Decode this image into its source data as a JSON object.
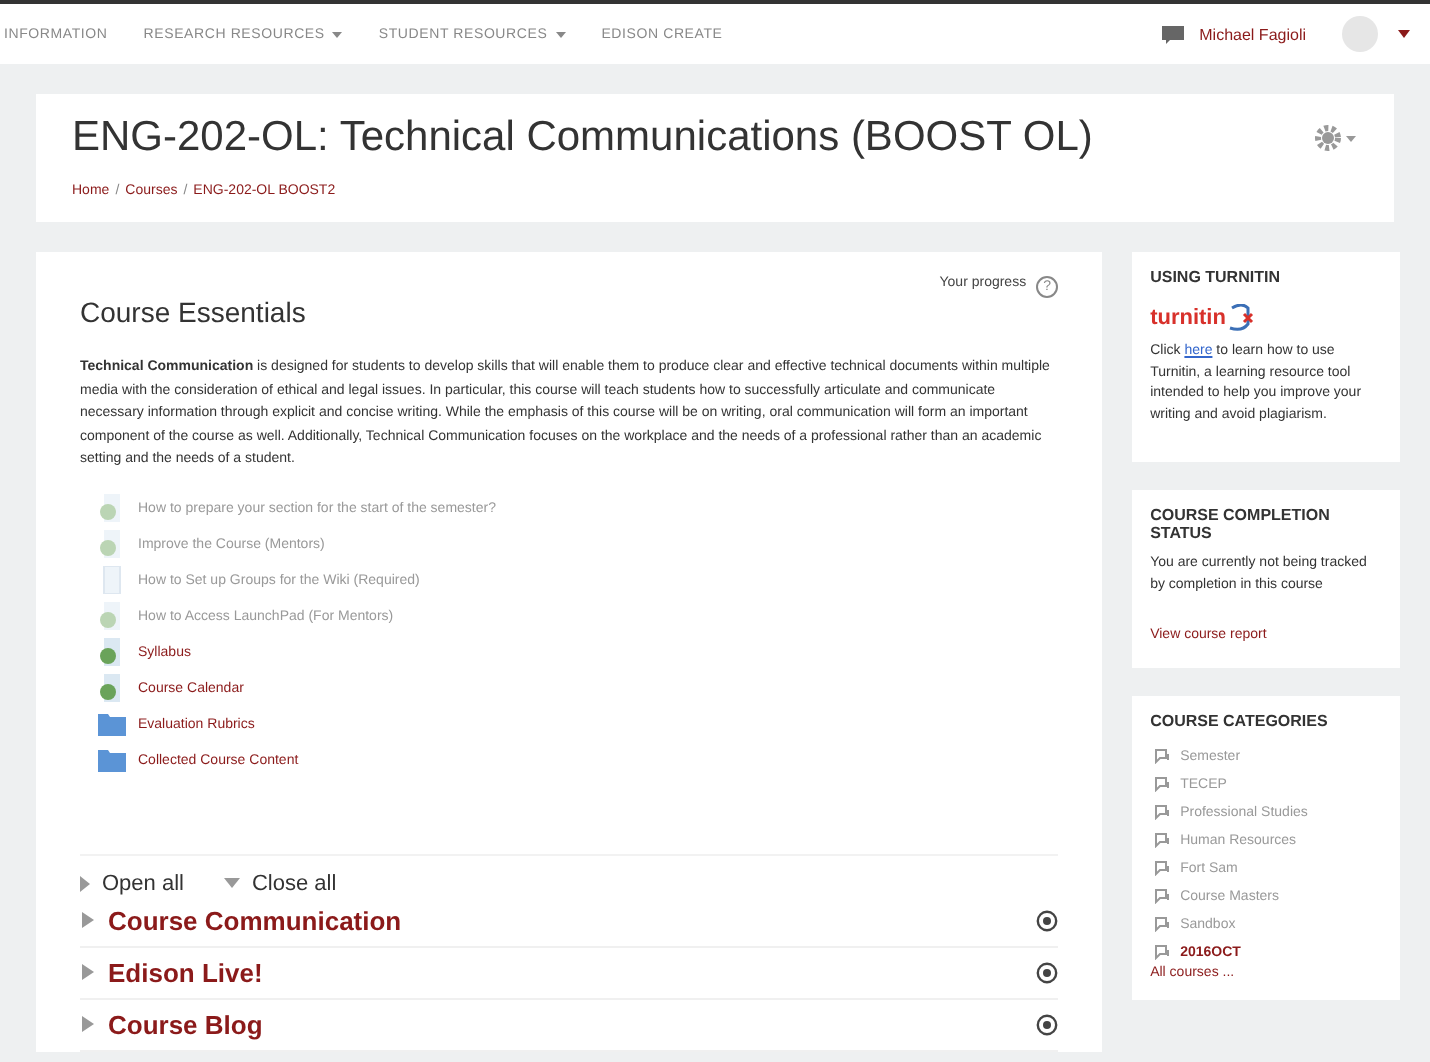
{
  "navbar": {
    "items": [
      {
        "label": "INFORMATION",
        "dropdown": false
      },
      {
        "label": "RESEARCH RESOURCES",
        "dropdown": true
      },
      {
        "label": "STUDENT RESOURCES",
        "dropdown": true
      },
      {
        "label": "EDISON CREATE",
        "dropdown": false
      }
    ],
    "user": "Michael Fagioli"
  },
  "header": {
    "title": "ENG-202-OL: Technical Communications (BOOST OL)",
    "breadcrumb": [
      "Home",
      "Courses",
      "ENG-202-OL BOOST2"
    ],
    "separator": "/"
  },
  "section": {
    "title": "Course Essentials",
    "progress": "Your progress",
    "help_mark": "?",
    "summary": "**Technical Communication** is designed for students to develop skills that will enable them to produce clear and effective technical documents within multiple media with the consideration of ethical and legal issues. In particular, this course will teach students how to successfully articulate and communicate necessary information through explicit and concise writing. While the emphasis of this course will be on writing, oral communication will form an important component of the course as well. Additionally, Technical Communication focuses on the workplace and the needs of a professional rather than an academic setting and the needs of a student.",
    "activities": [
      {
        "kind": "page",
        "label": "How to prepare your section for the start of the semester?",
        "dimmed": true
      },
      {
        "kind": "page",
        "label": "Improve the Course (Mentors)",
        "dimmed": true
      },
      {
        "kind": "file",
        "label": "How to Set up Groups for the Wiki (Required)",
        "dimmed": true
      },
      {
        "kind": "page",
        "label": "How to Access LaunchPad (For Mentors)",
        "dimmed": true
      },
      {
        "kind": "page",
        "label": "Syllabus",
        "dimmed": false
      },
      {
        "kind": "page",
        "label": "Course Calendar",
        "dimmed": false
      },
      {
        "kind": "folder",
        "label": "Evaluation Rubrics",
        "dimmed": false
      },
      {
        "kind": "folder",
        "label": "Collected Course Content",
        "dimmed": false
      }
    ]
  },
  "toggles": {
    "open_all": "Open all",
    "close_all": "Close all"
  },
  "topics": [
    {
      "title": "Course Communication",
      "expanded": false
    },
    {
      "title": "Edison Live!",
      "expanded": false
    },
    {
      "title": "Course Blog",
      "expanded": false
    }
  ],
  "blocks": {
    "turnitin": {
      "title": "USING TURNITIN",
      "logo": "turnitin",
      "text_before": "Click ",
      "link": "here",
      "text_after": " to learn how to use Turnitin, a learning resource tool intended to help you improve your writing and avoid plagiarism."
    },
    "completion": {
      "title": "COURSE COMPLETION STATUS",
      "text": "You are currently not being tracked by completion in this course",
      "link": "View course report"
    },
    "categories": {
      "title": "COURSE CATEGORIES",
      "items": [
        {
          "label": "Semester",
          "selected": false
        },
        {
          "label": "TECEP",
          "selected": false
        },
        {
          "label": "Professional Studies",
          "selected": false
        },
        {
          "label": "Human Resources",
          "selected": false
        },
        {
          "label": "Fort Sam",
          "selected": false
        },
        {
          "label": "Course Masters",
          "selected": false
        },
        {
          "label": "Sandbox",
          "selected": false
        },
        {
          "label": "2016OCT",
          "selected": true
        }
      ],
      "all_link": "All courses ..."
    }
  }
}
